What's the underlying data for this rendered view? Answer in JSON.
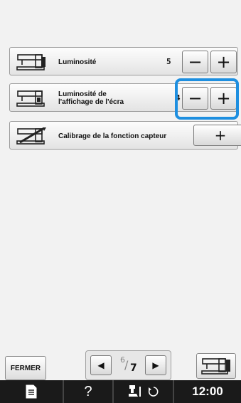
{
  "settings": [
    {
      "label_line1": "Luminosité",
      "label_line2": "",
      "value": "5",
      "minus": "−",
      "plus": "+"
    },
    {
      "label_line1": "Luminosité de",
      "label_line2": "l'affichage de l'écra",
      "value": "4",
      "minus": "−",
      "plus": "+"
    },
    {
      "label_line1": "Calibrage de la fonction capteur",
      "label_line2": "",
      "button": "+"
    }
  ],
  "footer": {
    "close_label": "FERMER",
    "prev_arrow": "◀",
    "next_arrow": "▶",
    "page_current": "6",
    "page_slash": "/",
    "page_total": "7"
  },
  "statusbar": {
    "question": "?",
    "clock": "12:00"
  },
  "icons": {
    "row1": "sewing-machine-icon",
    "row2": "sewing-machine-screen-icon",
    "row3": "sensor-calibration-icon",
    "machine_button": "sewing-machine-icon",
    "doc": "document-icon",
    "help": "help-icon",
    "foot": "presser-foot-icon",
    "swap": "rotate-icon"
  },
  "colors": {
    "highlight": "#1e8fe0",
    "statusbar": "#1a1a1a"
  }
}
